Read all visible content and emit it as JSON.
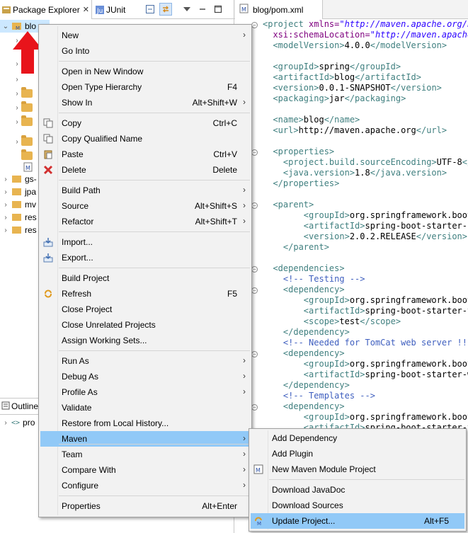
{
  "views": {
    "package_explorer_tab": "Package Explorer",
    "junit_tab": "JUnit",
    "outline_tab": "Outline",
    "editor_tab": "blog/pom.xml"
  },
  "tree": {
    "items": [
      {
        "label": "blo"
      },
      {
        "label": "gs-"
      },
      {
        "label": "jpa"
      },
      {
        "label": "mv"
      },
      {
        "label": "res"
      },
      {
        "label": "res"
      }
    ],
    "outline_item": "pro"
  },
  "context_menu": {
    "items": [
      {
        "label": "New",
        "shortcut": ""
      },
      {
        "label": "Go Into",
        "shortcut": ""
      },
      {
        "label": "Open in New Window",
        "shortcut": ""
      },
      {
        "label": "Open Type Hierarchy",
        "shortcut": "F4"
      },
      {
        "label": "Show In",
        "shortcut": "Alt+Shift+W"
      },
      {
        "label": "Copy",
        "shortcut": "Ctrl+C"
      },
      {
        "label": "Copy Qualified Name",
        "shortcut": ""
      },
      {
        "label": "Paste",
        "shortcut": "Ctrl+V"
      },
      {
        "label": "Delete",
        "shortcut": "Delete"
      },
      {
        "label": "Build Path",
        "shortcut": ""
      },
      {
        "label": "Source",
        "shortcut": "Alt+Shift+S"
      },
      {
        "label": "Refactor",
        "shortcut": "Alt+Shift+T"
      },
      {
        "label": "Import...",
        "shortcut": ""
      },
      {
        "label": "Export...",
        "shortcut": ""
      },
      {
        "label": "Build Project",
        "shortcut": ""
      },
      {
        "label": "Refresh",
        "shortcut": "F5"
      },
      {
        "label": "Close Project",
        "shortcut": ""
      },
      {
        "label": "Close Unrelated Projects",
        "shortcut": ""
      },
      {
        "label": "Assign Working Sets...",
        "shortcut": ""
      },
      {
        "label": "Run As",
        "shortcut": ""
      },
      {
        "label": "Debug As",
        "shortcut": ""
      },
      {
        "label": "Profile As",
        "shortcut": ""
      },
      {
        "label": "Validate",
        "shortcut": ""
      },
      {
        "label": "Restore from Local History...",
        "shortcut": ""
      },
      {
        "label": "Maven",
        "shortcut": ""
      },
      {
        "label": "Team",
        "shortcut": ""
      },
      {
        "label": "Compare With",
        "shortcut": ""
      },
      {
        "label": "Configure",
        "shortcut": ""
      },
      {
        "label": "Properties",
        "shortcut": "Alt+Enter"
      }
    ]
  },
  "maven_submenu": {
    "items": [
      {
        "label": "Add Dependency",
        "shortcut": ""
      },
      {
        "label": "Add Plugin",
        "shortcut": ""
      },
      {
        "label": "New Maven Module Project",
        "shortcut": ""
      },
      {
        "label": "Download JavaDoc",
        "shortcut": ""
      },
      {
        "label": "Download Sources",
        "shortcut": ""
      },
      {
        "label": "Update Project...",
        "shortcut": "Alt+F5"
      }
    ]
  },
  "editor": {
    "lines": [
      [
        [
          "tg",
          "<project "
        ],
        [
          "at",
          "xmlns="
        ],
        [
          "av",
          "\"http://maven.apache.org/PO"
        ]
      ],
      [
        [
          "at",
          "  xsi:schemaLocation="
        ],
        [
          "av",
          "\"http://maven.apache.o"
        ]
      ],
      [
        [
          "tg",
          "  <modelVersion>"
        ],
        [
          "tx",
          "4.0.0"
        ],
        [
          "tg",
          "</modelVersion>"
        ]
      ],
      [],
      [
        [
          "tg",
          "  <groupId>"
        ],
        [
          "tx",
          "spring"
        ],
        [
          "tg",
          "</groupId>"
        ]
      ],
      [
        [
          "tg",
          "  <artifactId>"
        ],
        [
          "tx",
          "blog"
        ],
        [
          "tg",
          "</artifactId>"
        ]
      ],
      [
        [
          "tg",
          "  <version>"
        ],
        [
          "tx",
          "0.0.1-SNAPSHOT"
        ],
        [
          "tg",
          "</version>"
        ]
      ],
      [
        [
          "tg",
          "  <packaging>"
        ],
        [
          "tx",
          "jar"
        ],
        [
          "tg",
          "</packaging>"
        ]
      ],
      [],
      [
        [
          "tg",
          "  <name>"
        ],
        [
          "tx",
          "blog"
        ],
        [
          "tg",
          "</name>"
        ]
      ],
      [
        [
          "tg",
          "  <url>"
        ],
        [
          "tx",
          "http://maven.apache.org"
        ],
        [
          "tg",
          "</url>"
        ]
      ],
      [],
      [
        [
          "tg",
          "  <properties>"
        ]
      ],
      [
        [
          "tg",
          "    <project.build.sourceEncoding>"
        ],
        [
          "tx",
          "UTF-8"
        ],
        [
          "tg",
          "</p"
        ]
      ],
      [
        [
          "tg",
          "    <java.version>"
        ],
        [
          "tx",
          "1.8"
        ],
        [
          "tg",
          "</java.version>"
        ]
      ],
      [
        [
          "tg",
          "  </properties>"
        ]
      ],
      [],
      [
        [
          "tg",
          "  <parent>"
        ]
      ],
      [
        [
          "tg",
          "        <groupId>"
        ],
        [
          "tx",
          "org.springframework.boot"
        ],
        [
          "tg",
          "<"
        ]
      ],
      [
        [
          "tg",
          "        <artifactId>"
        ],
        [
          "tx",
          "spring-boot-starter-pa"
        ]
      ],
      [
        [
          "tg",
          "        <version>"
        ],
        [
          "tx",
          "2.0.2.RELEASE"
        ],
        [
          "tg",
          "</version>"
        ]
      ],
      [
        [
          "tg",
          "    </parent>"
        ]
      ],
      [],
      [
        [
          "tg",
          "  <dependencies>"
        ]
      ],
      [
        [
          "cm",
          "    <!-- Testing -->"
        ]
      ],
      [
        [
          "tg",
          "    <dependency>"
        ]
      ],
      [
        [
          "tg",
          "        <groupId>"
        ],
        [
          "tx",
          "org.springframework.boot"
        ],
        [
          "tg",
          "<"
        ]
      ],
      [
        [
          "tg",
          "        <artifactId>"
        ],
        [
          "tx",
          "spring-boot-starter-te"
        ]
      ],
      [
        [
          "tg",
          "        <scope>"
        ],
        [
          "tx",
          "test"
        ],
        [
          "tg",
          "</scope>"
        ]
      ],
      [
        [
          "tg",
          "    </dependency>"
        ]
      ],
      [
        [
          "cm",
          "    <!-- Needed for TomCat web server !! -"
        ]
      ],
      [
        [
          "tg",
          "    <dependency>"
        ]
      ],
      [
        [
          "tg",
          "        <groupId>"
        ],
        [
          "tx",
          "org.springframework.boot"
        ],
        [
          "tg",
          "<"
        ]
      ],
      [
        [
          "tg",
          "        <artifactId>"
        ],
        [
          "tx",
          "spring-boot-starter-we"
        ]
      ],
      [
        [
          "tg",
          "    </dependency>"
        ]
      ],
      [
        [
          "cm",
          "    <!-- Templates -->"
        ]
      ],
      [
        [
          "tg",
          "    <dependency>"
        ]
      ],
      [
        [
          "tg",
          "        <groupId>"
        ],
        [
          "tx",
          "org.springframework.boot"
        ],
        [
          "tg",
          "<"
        ]
      ],
      [
        [
          "tg",
          "        <artifactId>"
        ],
        [
          "tx",
          "spring-boot-starter-th"
        ]
      ]
    ]
  },
  "colors": {
    "menu_highlight": "#91c9f7",
    "arrow": "#e8141b",
    "xml_tag": "#3f7f7f",
    "xml_attr": "#7f007f",
    "xml_value": "#2a00ff",
    "xml_comment": "#3f5fbf"
  },
  "icons": {
    "copy": "copy-icon",
    "copy_qualified": "copy-qualified-icon",
    "paste": "paste-icon",
    "delete": "delete-icon",
    "import": "import-icon",
    "export": "export-icon",
    "refresh": "refresh-icon",
    "maven_module": "maven-module-icon",
    "update_project": "update-project-icon"
  }
}
